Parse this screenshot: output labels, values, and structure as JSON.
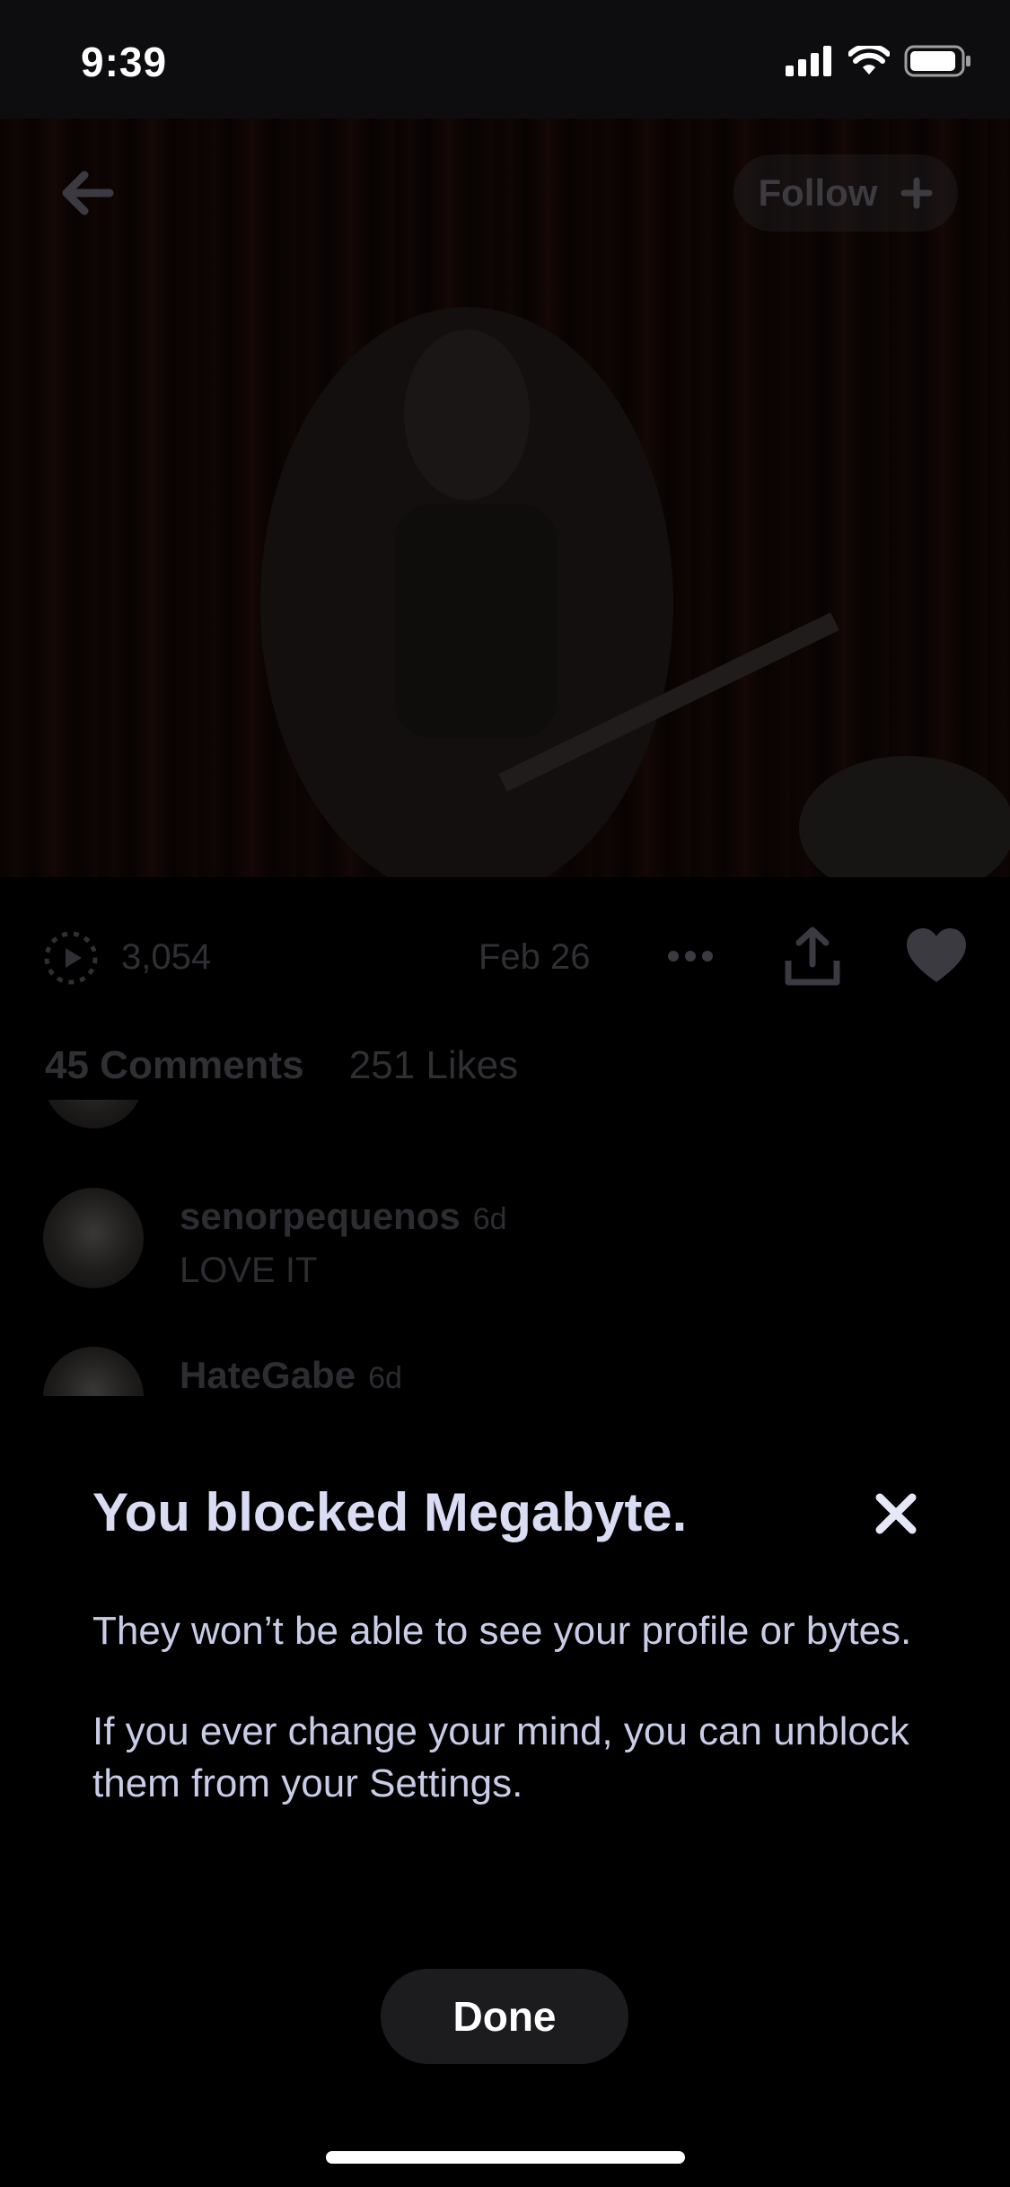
{
  "status_bar": {
    "time": "9:39"
  },
  "header": {
    "follow_label": "Follow"
  },
  "meta": {
    "views": "3,054",
    "date": "Feb 26"
  },
  "counts": {
    "comments": "45 Comments",
    "likes": "251 Likes"
  },
  "comments": [
    {
      "username": "senorpequenos",
      "age": "6d",
      "text": "LOVE IT"
    },
    {
      "username": "HateGabe",
      "age": "6d",
      "text": ""
    }
  ],
  "dialog": {
    "title": "You blocked Megabyte.",
    "body_1": "They won’t be able to see your profile or bytes.",
    "body_2": "If you ever change your mind, you can unblock them from your Settings.",
    "done_label": "Done"
  },
  "icons": {
    "back": "back-arrow-icon",
    "follow": "plus-icon",
    "views": "play-circle-icon",
    "more": "more-dots-icon",
    "share": "share-icon",
    "like": "heart-icon",
    "close": "close-icon"
  }
}
